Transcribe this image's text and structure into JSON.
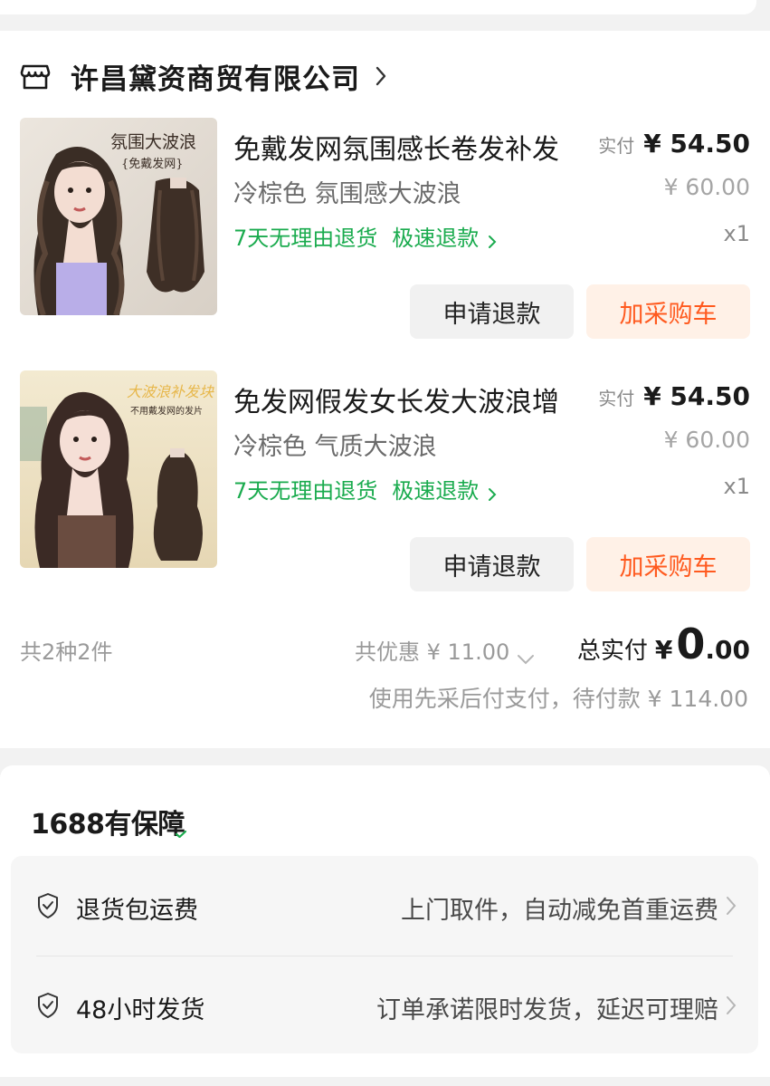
{
  "shop": {
    "name": "许昌黛资商贸有限公司"
  },
  "products": [
    {
      "thumb_banner": "氛围大波浪",
      "thumb_subtitle": "{免戴发网}",
      "title": "免戴发网氛围感长卷发补发",
      "variant": "冷棕色 氛围感大波浪",
      "policy_return": "7天无理由退货",
      "policy_refund": "极速退款",
      "price_label": "实付",
      "price": "¥ 54.50",
      "original_price": "¥ 60.00",
      "quantity": "x1",
      "refund_button": "申请退款",
      "cart_button": "加采购车"
    },
    {
      "thumb_banner": "大波浪补发块",
      "thumb_subtitle": "不用戴发网的发片",
      "title": "免发网假发女长发大波浪增",
      "variant": "冷棕色 气质大波浪",
      "policy_return": "7天无理由退货",
      "policy_refund": "极速退款",
      "price_label": "实付",
      "price": "¥ 54.50",
      "original_price": "¥ 60.00",
      "quantity": "x1",
      "refund_button": "申请退款",
      "cart_button": "加采购车"
    }
  ],
  "summary": {
    "count": "共2种2件",
    "discount": "共优惠 ¥ 11.00",
    "total_label": "总实付",
    "total_currency": "¥",
    "total_int": "0",
    "total_dec": ".00",
    "pay_note": "使用先采后付支付，待付款 ¥ 114.00"
  },
  "guarantee": {
    "title_prefix": "1688",
    "title_main": "有保",
    "title_last": "障",
    "items": [
      {
        "name": "退货包运费",
        "desc": "上门取件，自动减免首重运费"
      },
      {
        "name": "48小时发货",
        "desc": "订单承诺限时发货，延迟可理赔"
      }
    ]
  },
  "colors": {
    "accent_orange": "#ff5a1f",
    "policy_green": "#1aab4e",
    "cart_bg": "#fff1e7"
  }
}
